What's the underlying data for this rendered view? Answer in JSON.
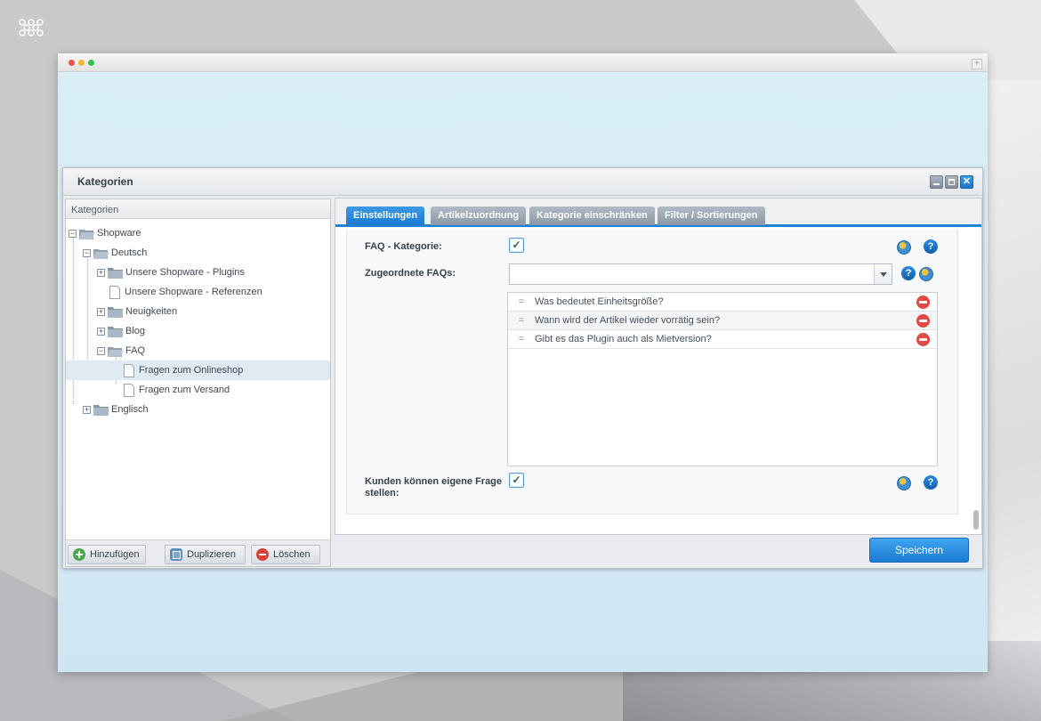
{
  "window": {
    "title": "Kategorien"
  },
  "tree_panel": {
    "header": "Kategorien",
    "nodes": [
      {
        "label": "Shopware",
        "expander": "−"
      },
      {
        "label": "Deutsch",
        "expander": "−"
      },
      {
        "label": "Unsere Shopware - Plugins",
        "expander": "+"
      },
      {
        "label": "Unsere Shopware - Referenzen",
        "expander": ""
      },
      {
        "label": "Neuigkeiten",
        "expander": "+"
      },
      {
        "label": "Blog",
        "expander": "+"
      },
      {
        "label": "FAQ",
        "expander": "−"
      },
      {
        "label": "Fragen zum Onlineshop",
        "expander": ""
      },
      {
        "label": "Fragen zum Versand",
        "expander": ""
      },
      {
        "label": "Englisch",
        "expander": "+"
      }
    ],
    "selected": "Fragen zum Onlineshop",
    "buttons": {
      "add": "Hinzufügen",
      "duplicate": "Duplizieren",
      "delete": "Löschen"
    }
  },
  "tabs": [
    {
      "label": "Einstellungen",
      "active": true
    },
    {
      "label": "Artikelzuordnung",
      "active": false
    },
    {
      "label": "Kategorie einschränken",
      "active": false
    },
    {
      "label": "Filter / Sortierungen",
      "active": false
    }
  ],
  "form": {
    "faq_category_label": "FAQ - Kategorie:",
    "faq_category_checked": true,
    "assigned_faqs_label": "Zugeordnete FAQs:",
    "assigned_faqs_value": "",
    "faqs": [
      "Was bedeutet Einheitsgröße?",
      "Wann wird der Artikel wieder vorrätig sein?",
      "Gibt es das Plugin auch als Mietversion?"
    ],
    "drag_glyph": "=",
    "customers_question_label_1": "Kunden können eigene Frage",
    "customers_question_label_2": "stellen:",
    "customers_question_checked": true,
    "check_glyph": "✓",
    "help_glyph": "?"
  },
  "save_button": "Speichern",
  "window_tools": {
    "close_glyph": "✕",
    "plus_glyph": "+"
  },
  "colors": {
    "accent": "#1c83d6",
    "delete": "#df4a45",
    "add": "#49a84a"
  }
}
